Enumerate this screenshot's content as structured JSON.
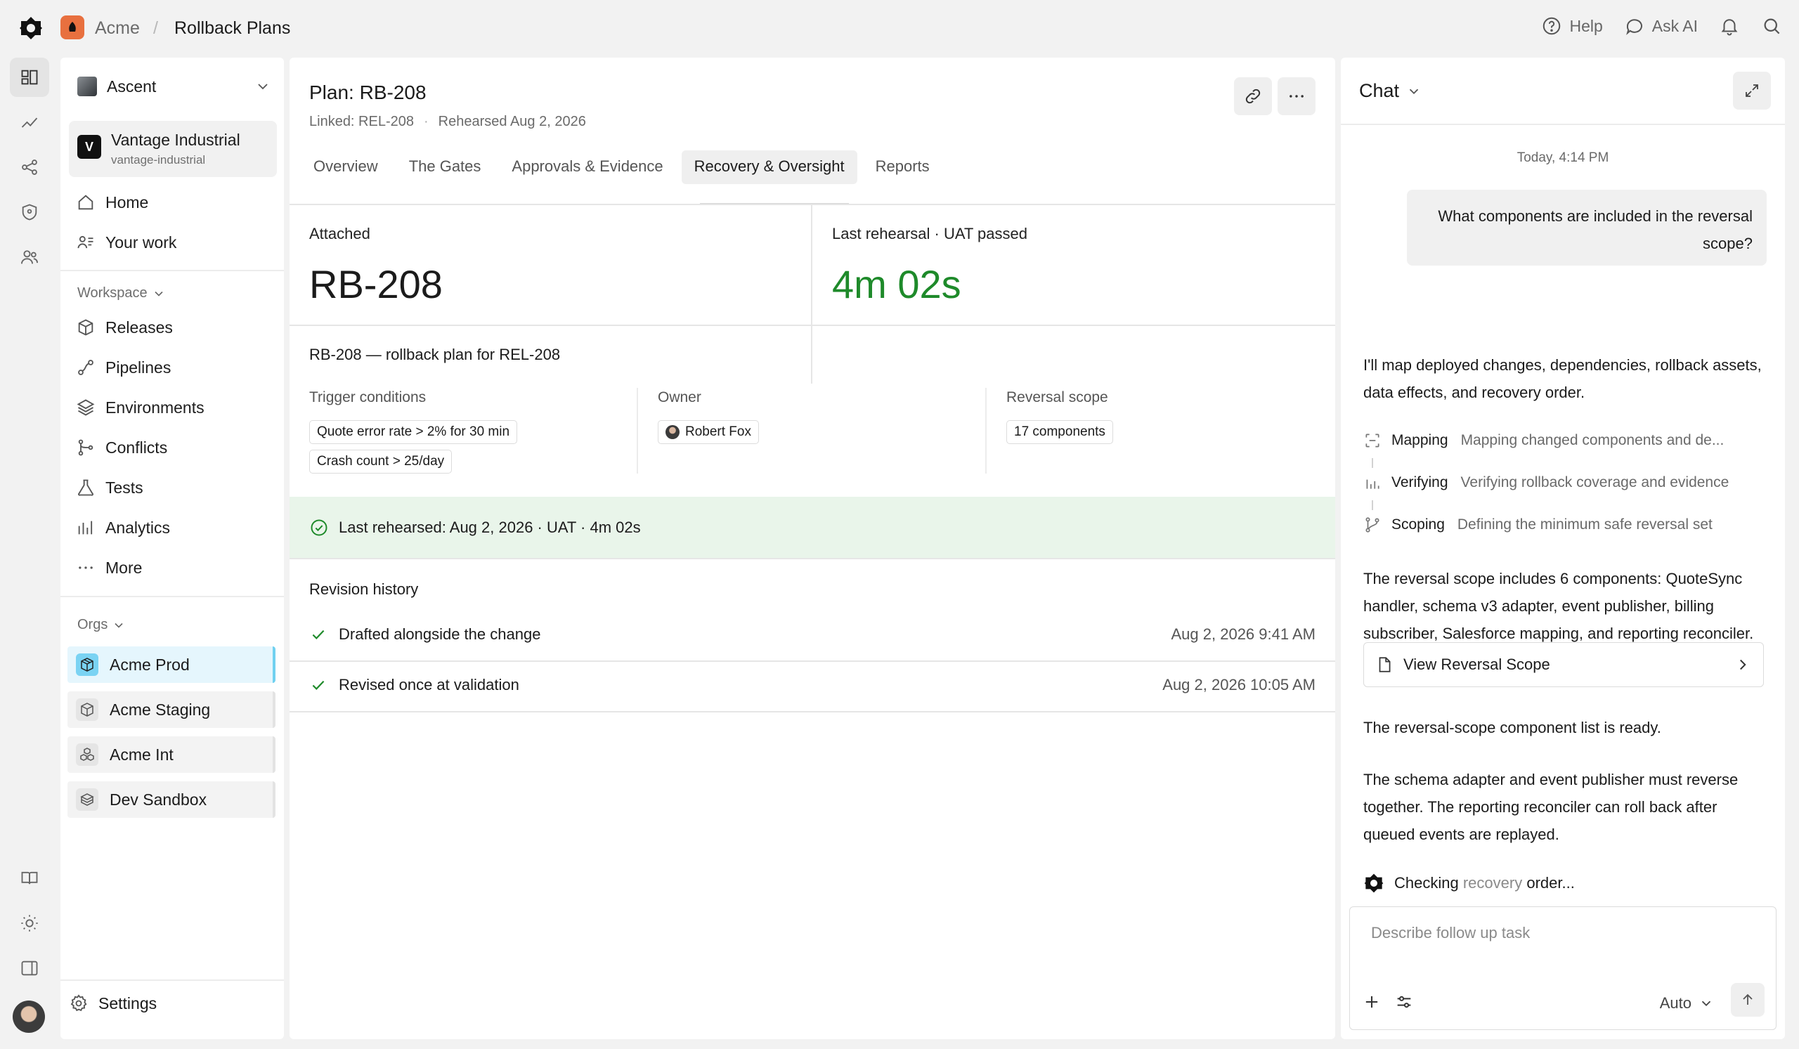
{
  "topbar": {
    "org": "Acme",
    "separator": "/",
    "page": "Rollback Plans",
    "help": "Help",
    "ask_ai": "Ask AI"
  },
  "sidebar": {
    "workspace": "Ascent",
    "tenant": {
      "badge": "V",
      "name": "Vantage Industrial",
      "slug": "vantage-industrial"
    },
    "top_nav": [
      {
        "label": "Home",
        "icon": "home-icon"
      },
      {
        "label": "Your work",
        "icon": "your-work-icon"
      }
    ],
    "workspace_label": "Workspace",
    "workspace_nav": [
      {
        "label": "Releases",
        "icon": "package-icon"
      },
      {
        "label": "Pipelines",
        "icon": "pipeline-icon"
      },
      {
        "label": "Environments",
        "icon": "layers-icon"
      },
      {
        "label": "Conflicts",
        "icon": "git-merge-icon"
      },
      {
        "label": "Tests",
        "icon": "flask-icon"
      },
      {
        "label": "Analytics",
        "icon": "bar-chart-icon"
      },
      {
        "label": "More",
        "icon": "more-icon"
      }
    ],
    "orgs_label": "Orgs",
    "orgs": [
      {
        "label": "Acme Prod",
        "active": true
      },
      {
        "label": "Acme Staging",
        "active": false
      },
      {
        "label": "Acme Int",
        "active": false
      },
      {
        "label": "Dev Sandbox",
        "active": false
      }
    ],
    "settings": "Settings"
  },
  "main": {
    "title": "Plan: RB-208",
    "linked": "Linked: REL-208",
    "dot": "·",
    "rehearsed_meta": "Rehearsed Aug 2, 2026",
    "tabs": [
      "Overview",
      "The Gates",
      "Approvals & Evidence",
      "Recovery & Oversight",
      "Reports"
    ],
    "active_tab": 3,
    "stats": {
      "attached_label": "Attached",
      "attached_value": "RB-208",
      "rehearsal_label": "Last rehearsal · UAT passed",
      "rehearsal_value": "4m 02s"
    },
    "description": "RB-208 — rollback plan for REL-208",
    "trigger_label": "Trigger conditions",
    "triggers": [
      "Quote error rate > 2% for 30 min",
      "Crash count > 25/day"
    ],
    "owner_label": "Owner",
    "owner": "Robert Fox",
    "scope_label": "Reversal scope",
    "scope": "17 components",
    "rehearsed_banner": "Last rehearsed: Aug 2, 2026 · UAT · 4m 02s",
    "revision_title": "Revision history",
    "revisions": [
      {
        "text": "Drafted alongside the change",
        "time": "Aug 2, 2026 9:41 AM"
      },
      {
        "text": "Revised once at validation",
        "time": "Aug 2, 2026 10:05 AM"
      }
    ],
    "colors": {
      "success": "#1e8a2a",
      "banner_bg": "#e9f5ea"
    }
  },
  "chat": {
    "title": "Chat",
    "timestamp": "Today, 4:14 PM",
    "user_message": "What components are included in the reversal scope?",
    "intro": "I'll map deployed changes, dependencies, rollback assets, data effects, and recovery order.",
    "steps": [
      {
        "label": "Mapping",
        "desc": "Mapping changed components and de..."
      },
      {
        "label": "Verifying",
        "desc": "Verifying rollback coverage and evidence"
      },
      {
        "label": "Scoping",
        "desc": "Defining the minimum safe reversal set"
      }
    ],
    "summary": "The reversal scope includes 6 components: QuoteSync handler, schema v3 adapter, event publisher, billing subscriber, Salesforce mapping, and reporting reconciler.",
    "card_label": "View Reversal Scope",
    "ready": "The reversal-scope component list is ready.",
    "note": "The schema adapter and event publisher must reverse together. The reporting reconciler can roll back after queued events are replayed.",
    "checking_prefix": "Checking",
    "checking_faded": "recovery",
    "checking_suffix": "order...",
    "composer_placeholder": "Describe follow up task",
    "mode": "Auto"
  }
}
